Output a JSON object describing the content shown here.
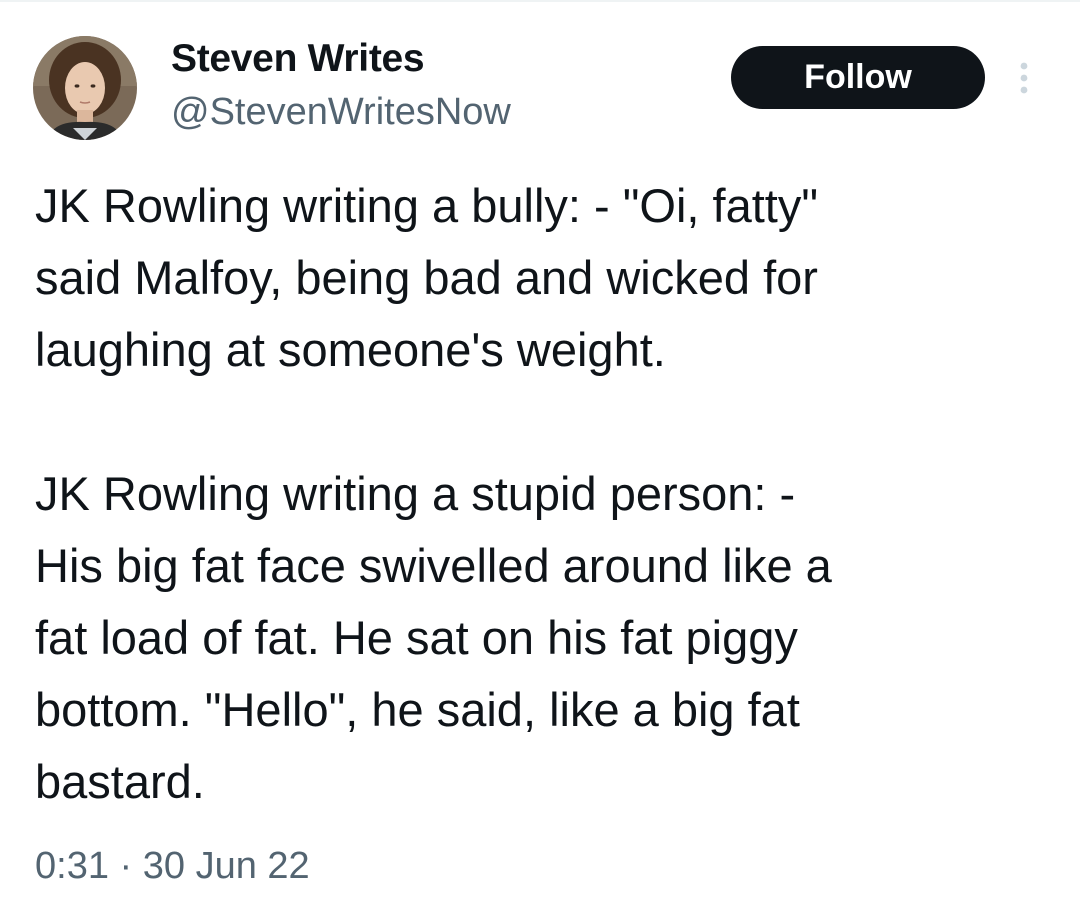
{
  "author": {
    "display_name": "Steven Writes",
    "handle": "@StevenWritesNow",
    "avatar_icon": "profile-photo"
  },
  "actions": {
    "follow_label": "Follow",
    "more_icon": "more-vertical-icon"
  },
  "tweet": {
    "text": "JK Rowling writing a bully: - \"Oi, fatty\"\nsaid Malfoy, being bad and wicked for\nlaughing at someone's weight.\n\nJK Rowling writing a stupid person: -\nHis big fat face swivelled around like a\nfat load of fat. He sat on his fat piggy\nbottom. \"Hello\", he said, like a big fat\nbastard.",
    "time": "0:31",
    "separator": "·",
    "date": "30 Jun 22"
  },
  "colors": {
    "text_primary": "#0f1419",
    "text_secondary": "#536471",
    "button_bg": "#0f1419",
    "button_text": "#ffffff"
  }
}
